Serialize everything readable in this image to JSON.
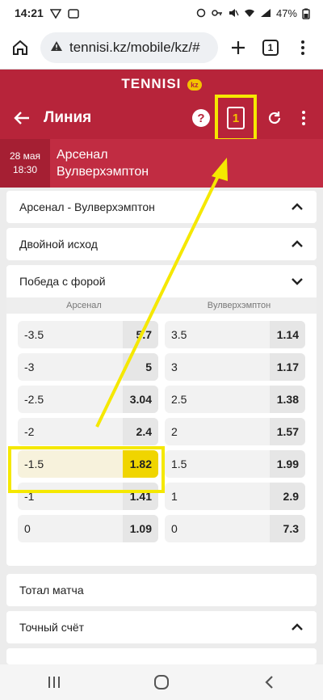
{
  "status": {
    "time": "14:21",
    "battery": "47%"
  },
  "browser": {
    "url": "tennisi.kz/mobile/kz/#",
    "tab_count": "1"
  },
  "app": {
    "brand": "TENNISI",
    "brand_badge": "kz",
    "title": "Линия",
    "coupon_count": "1"
  },
  "match": {
    "date": "28 мая",
    "time": "18:30",
    "team1": "Арсенал",
    "team2": "Вулверхэмптон"
  },
  "sections": [
    {
      "title": "Арсенал - Вулверхэмптон",
      "chevron": "chevron-up-icon"
    },
    {
      "title": "Двойной исход",
      "chevron": "chevron-up-icon"
    },
    {
      "title": "Победа с форой",
      "chevron": "chevron-down-icon"
    },
    {
      "title": "Тотал матча",
      "chevron": "none"
    },
    {
      "title": "Точный счёт",
      "chevron": "chevron-up-icon"
    }
  ],
  "handicap": {
    "col1": "Арсенал",
    "col2": "Вулверхэмптон",
    "rows": [
      {
        "h1": "-3.5",
        "o1": "5.7",
        "h2": "3.5",
        "o2": "1.14"
      },
      {
        "h1": "-3",
        "o1": "5",
        "h2": "3",
        "o2": "1.17"
      },
      {
        "h1": "-2.5",
        "o1": "3.04",
        "h2": "2.5",
        "o2": "1.38"
      },
      {
        "h1": "-2",
        "o1": "2.4",
        "h2": "2",
        "o2": "1.57"
      },
      {
        "h1": "-1.5",
        "o1": "1.82",
        "h2": "1.5",
        "o2": "1.99"
      },
      {
        "h1": "-1",
        "o1": "1.41",
        "h2": "1",
        "o2": "2.9"
      },
      {
        "h1": "0",
        "o1": "1.09",
        "h2": "0",
        "o2": "7.3"
      }
    ]
  },
  "colors": {
    "header": "#b7243a",
    "highlight": "#f5e800",
    "selected_odd": "#f0d500"
  }
}
